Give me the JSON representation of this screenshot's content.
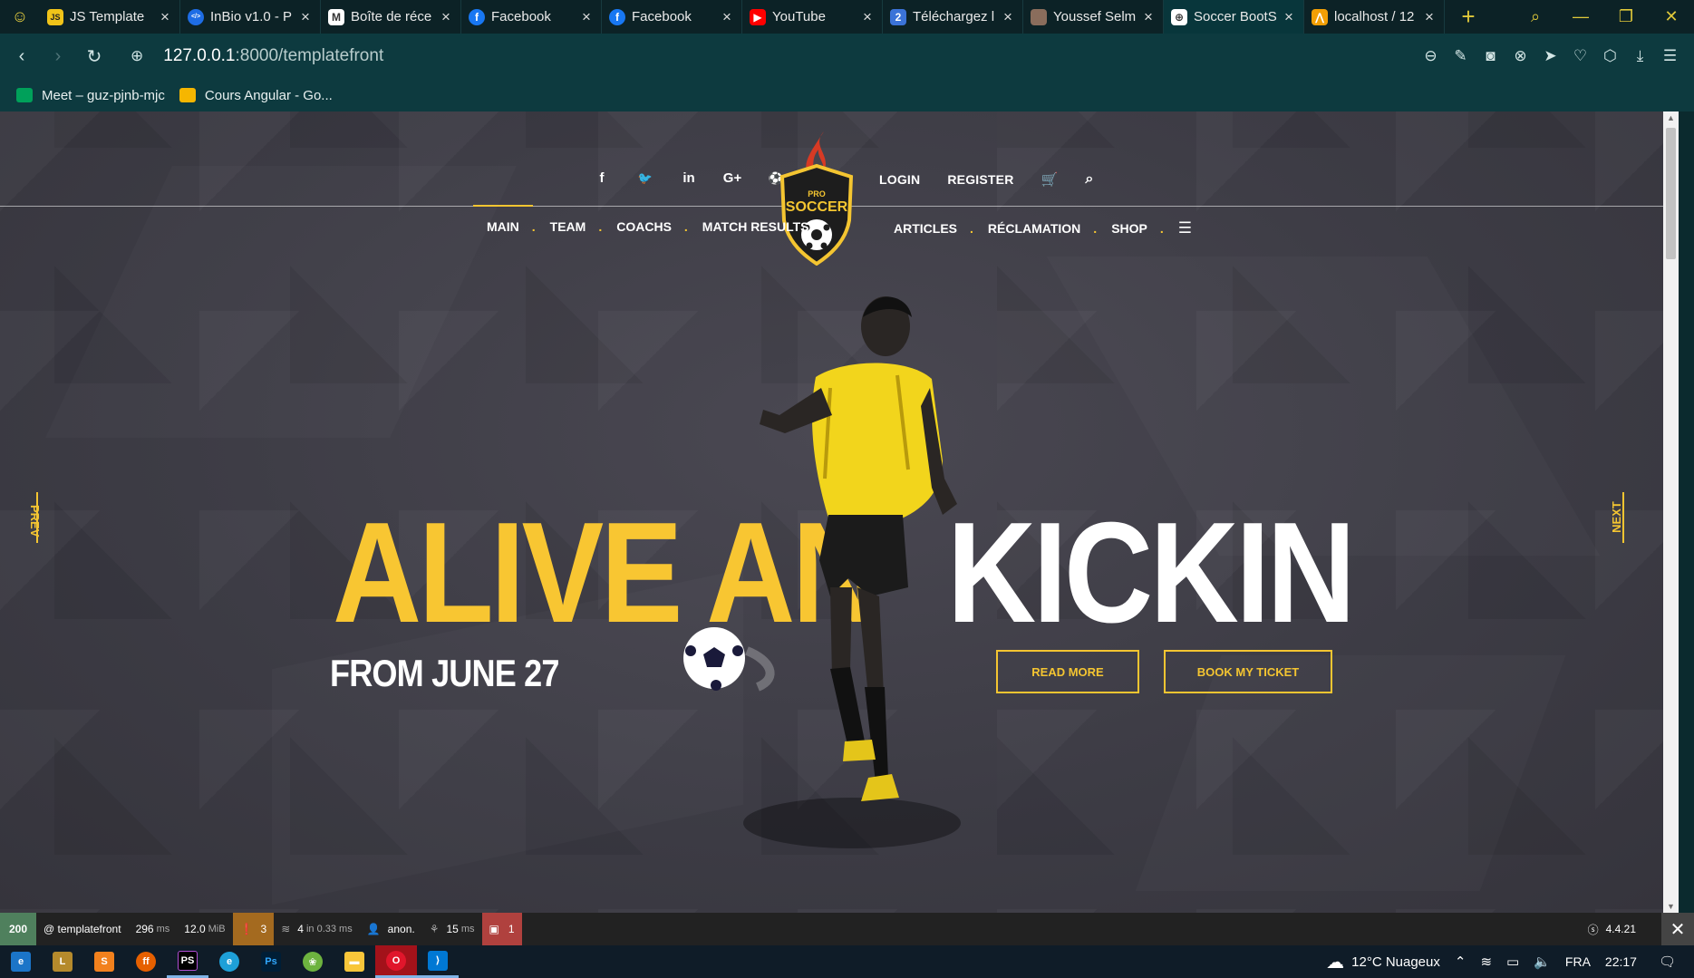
{
  "browser": {
    "tabs": [
      {
        "title": "JS Template",
        "favicon": "js-icon",
        "color": "#f0c419",
        "active": false
      },
      {
        "title": "InBio v1.0 - P",
        "favicon": "code-icon",
        "color": "#1e6de5",
        "active": false
      },
      {
        "title": "Boîte de réce",
        "favicon": "gmail-icon",
        "color": "#ffffff",
        "active": false
      },
      {
        "title": "Facebook",
        "favicon": "facebook-icon",
        "color": "#1877f2",
        "active": false
      },
      {
        "title": "Facebook",
        "favicon": "facebook-icon",
        "color": "#1877f2",
        "active": false
      },
      {
        "title": "YouTube",
        "favicon": "youtube-icon",
        "color": "#ff0000",
        "active": false
      },
      {
        "title": "Téléchargez l",
        "favicon": "number-2-icon",
        "color": "#3b73d8",
        "active": false
      },
      {
        "title": "Youssef Selm",
        "favicon": "avatar-icon",
        "color": "#8a6d5c",
        "active": false
      },
      {
        "title": "Soccer BootS",
        "favicon": "globe-icon",
        "color": "#ffffff",
        "active": true
      },
      {
        "title": "localhost / 12",
        "favicon": "phpmyadmin-icon",
        "color": "#f29f05",
        "active": false
      }
    ],
    "url_host": "127.0.0.1",
    "url_rest": ":8000/templatefront",
    "bookmarks": [
      {
        "label": "Meet – guz-pjnb-mjc",
        "icon": "meet-icon",
        "color": "#00a05a"
      },
      {
        "label": "Cours Angular - Go...",
        "icon": "slides-icon",
        "color": "#f6b600"
      }
    ]
  },
  "site": {
    "social_icons": [
      "facebook-icon",
      "twitter-icon",
      "linkedin-icon",
      "google-plus-icon",
      "dribbble-icon"
    ],
    "social_glyphs": [
      "f",
      "🐦",
      "in",
      "G+",
      "⚽"
    ],
    "top_links": {
      "login": "LOGIN",
      "register": "REGISTER"
    },
    "logo": {
      "small": "PRO",
      "big": "SOCCER"
    },
    "menu_left": [
      "MAIN",
      "TEAM",
      "COACHS",
      "MATCH RESULTS"
    ],
    "menu_right": [
      "ARTICLES",
      "RÉCLAMATION",
      "SHOP"
    ],
    "hero": {
      "title_part1": "ALIVE AN",
      "title_part2": "KICKIN",
      "subtitle": "FROM JUNE 27",
      "btn_read_more": "READ MORE",
      "btn_book": "BOOK MY TICKET",
      "prev": "PREV",
      "next": "NEXT"
    },
    "accent_color": "#f4c531"
  },
  "symfony_toolbar": {
    "status": "200",
    "route": "@ templatefront",
    "time_value": "296",
    "time_unit": "ms",
    "memory_value": "12.0",
    "memory_unit": "MiB",
    "warnings": "3",
    "queries": "4",
    "queries_detail": "in 0.33 ms",
    "user": "anon.",
    "twig_value": "15",
    "twig_unit": "ms",
    "errors": "1",
    "version": "4.4.21"
  },
  "taskbar": {
    "weather": "12°C  Nuageux",
    "language": "FRA",
    "clock": "22:17"
  }
}
